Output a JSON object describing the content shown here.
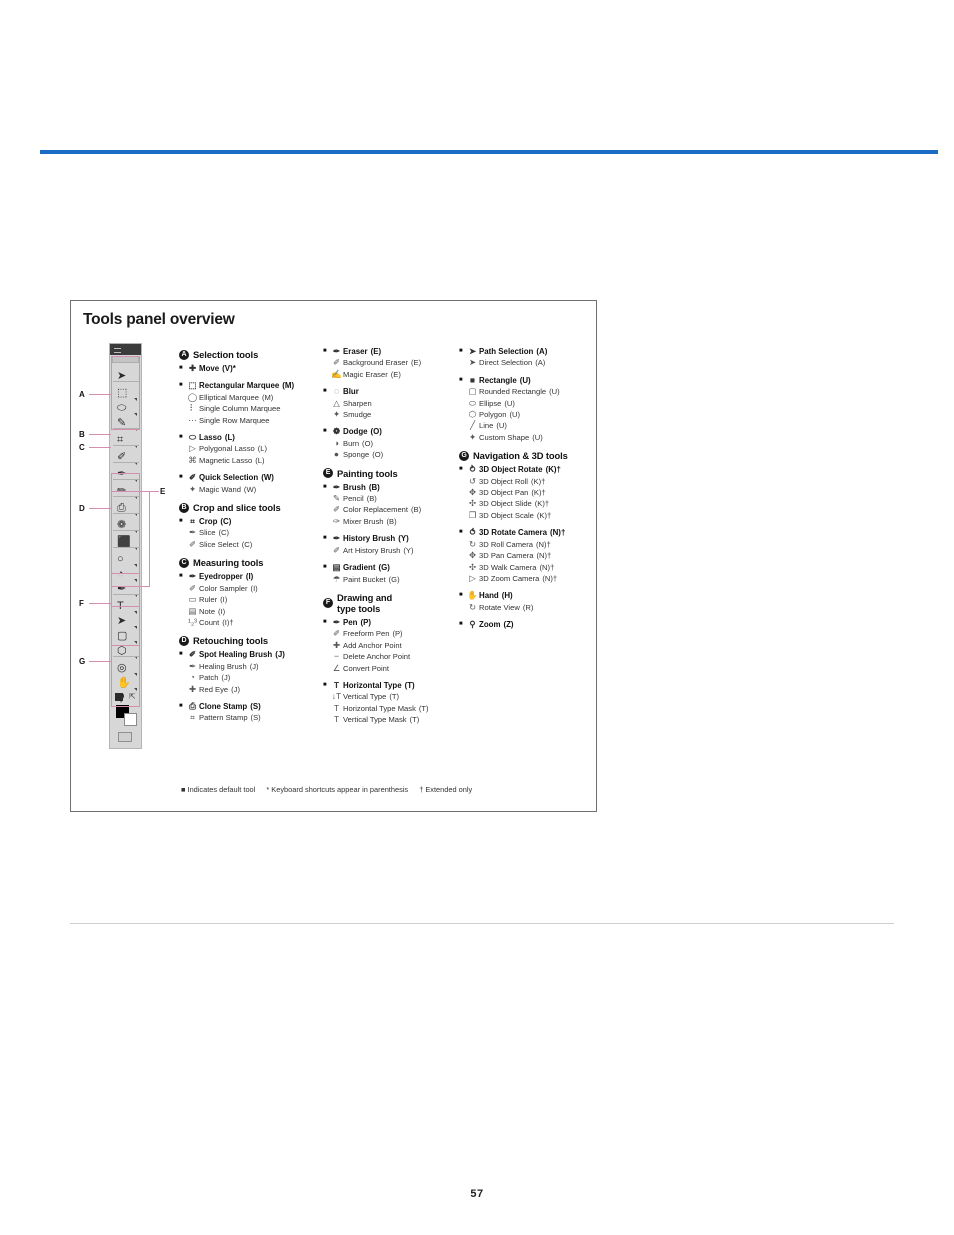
{
  "document": {
    "page_number": "57",
    "accent_color": "#1a6cc4",
    "rule_color": "#cfcfcf"
  },
  "figure": {
    "title": "Tools panel overview",
    "note": {
      "default_tool": "■ Indicates default tool",
      "shortcuts": "* Keyboard shortcuts appear in parenthesis",
      "extended": "† Extended only"
    },
    "callouts": [
      "A",
      "B",
      "C",
      "D",
      "E",
      "F",
      "G"
    ],
    "toolbar": {
      "items": [
        {
          "glyph": "➤",
          "flyout": false
        },
        {
          "glyph": "⬚",
          "flyout": true
        },
        {
          "glyph": "⬭",
          "flyout": true
        },
        {
          "glyph": "✎",
          "flyout": true
        },
        {
          "glyph": "⌗",
          "flyout": true
        },
        {
          "glyph": "✐",
          "flyout": true
        },
        {
          "glyph": "✒",
          "flyout": true
        },
        {
          "glyph": "✏",
          "flyout": true
        },
        {
          "glyph": "⎙",
          "flyout": true
        },
        {
          "glyph": "❁",
          "flyout": true
        },
        {
          "glyph": "⬛",
          "flyout": true
        },
        {
          "glyph": "○",
          "flyout": true
        },
        {
          "glyph": "◔",
          "flyout": true
        },
        {
          "glyph": "✒",
          "flyout": true
        },
        {
          "glyph": "T",
          "flyout": true
        },
        {
          "glyph": "➤",
          "flyout": true
        },
        {
          "glyph": "▢",
          "flyout": true
        },
        {
          "glyph": "⬡",
          "flyout": true
        },
        {
          "glyph": "◎",
          "flyout": true
        },
        {
          "glyph": "✋",
          "flyout": true
        },
        {
          "glyph": "⚲",
          "flyout": false
        }
      ]
    },
    "sections": [
      {
        "badge": "A",
        "title": "Selection tools",
        "column": 1,
        "groups": [
          {
            "tools": [
              {
                "default": true,
                "icon": "✚",
                "name": "Move",
                "key": "(V)*",
                "main": true
              }
            ]
          },
          {
            "tools": [
              {
                "default": true,
                "icon": "⬚",
                "name": "Rectangular Marquee",
                "key": "(M)",
                "main": true
              },
              {
                "default": false,
                "icon": "◯",
                "name": "Elliptical Marquee",
                "key": "(M)",
                "main": false
              },
              {
                "default": false,
                "icon": "⠇",
                "name": "Single Column Marquee",
                "key": "",
                "main": false
              },
              {
                "default": false,
                "icon": "⋯",
                "name": "Single Row Marquee",
                "key": "",
                "main": false
              }
            ]
          },
          {
            "tools": [
              {
                "default": true,
                "icon": "⬭",
                "name": "Lasso",
                "key": "(L)",
                "main": true
              },
              {
                "default": false,
                "icon": "▷",
                "name": "Polygonal Lasso",
                "key": "(L)",
                "main": false
              },
              {
                "default": false,
                "icon": "⌘",
                "name": "Magnetic Lasso",
                "key": "(L)",
                "main": false
              }
            ]
          },
          {
            "tools": [
              {
                "default": true,
                "icon": "✐",
                "name": "Quick Selection",
                "key": "(W)",
                "main": true
              },
              {
                "default": false,
                "icon": "✦",
                "name": "Magic Wand",
                "key": "(W)",
                "main": false
              }
            ]
          }
        ]
      },
      {
        "badge": "B",
        "title": "Crop and slice tools",
        "column": 1,
        "groups": [
          {
            "tools": [
              {
                "default": true,
                "icon": "⌗",
                "name": "Crop",
                "key": "(C)",
                "main": true
              },
              {
                "default": false,
                "icon": "✒",
                "name": "Slice",
                "key": "(C)",
                "main": false
              },
              {
                "default": false,
                "icon": "✐",
                "name": "Slice Select",
                "key": "(C)",
                "main": false
              }
            ]
          }
        ]
      },
      {
        "badge": "C",
        "title": "Measuring tools",
        "column": 1,
        "groups": [
          {
            "tools": [
              {
                "default": true,
                "icon": "✒",
                "name": "Eyedropper",
                "key": "(I)",
                "main": true
              },
              {
                "default": false,
                "icon": "✐",
                "name": "Color Sampler",
                "key": "(I)",
                "main": false
              },
              {
                "default": false,
                "icon": "▭",
                "name": "Ruler",
                "key": "(I)",
                "main": false
              },
              {
                "default": false,
                "icon": "▤",
                "name": "Note",
                "key": "(I)",
                "main": false
              },
              {
                "default": false,
                "icon": "¹₂³",
                "name": "Count",
                "key": "(I)†",
                "main": false
              }
            ]
          }
        ]
      },
      {
        "badge": "D",
        "title": "Retouching tools",
        "column": 1,
        "groups": [
          {
            "tools": [
              {
                "default": true,
                "icon": "✐",
                "name": "Spot Healing Brush",
                "key": "(J)",
                "main": true
              },
              {
                "default": false,
                "icon": "✒",
                "name": "Healing Brush",
                "key": "(J)",
                "main": false
              },
              {
                "default": false,
                "icon": "◔",
                "name": "Patch",
                "key": "(J)",
                "main": false
              },
              {
                "default": false,
                "icon": "✚",
                "name": "Red Eye",
                "key": "(J)",
                "main": false
              }
            ]
          },
          {
            "tools": [
              {
                "default": true,
                "icon": "⎙",
                "name": "Clone Stamp",
                "key": "(S)",
                "main": true
              },
              {
                "default": false,
                "icon": "⌗",
                "name": "Pattern Stamp",
                "key": "(S)",
                "main": false
              }
            ]
          }
        ]
      },
      {
        "badge": "",
        "title": "",
        "column": 2,
        "groups": [
          {
            "tools": [
              {
                "default": true,
                "icon": "✒",
                "name": "Eraser",
                "key": "(E)",
                "main": true
              },
              {
                "default": false,
                "icon": "✐",
                "name": "Background Eraser",
                "key": "(E)",
                "main": false
              },
              {
                "default": false,
                "icon": "✍",
                "name": "Magic Eraser",
                "key": "(E)",
                "main": false
              }
            ]
          },
          {
            "tools": [
              {
                "default": true,
                "icon": "◌",
                "name": "Blur",
                "key": "",
                "main": true
              },
              {
                "default": false,
                "icon": "△",
                "name": "Sharpen",
                "key": "",
                "main": false
              },
              {
                "default": false,
                "icon": "✦",
                "name": "Smudge",
                "key": "",
                "main": false
              }
            ]
          },
          {
            "tools": [
              {
                "default": true,
                "icon": "❁",
                "name": "Dodge",
                "key": "(O)",
                "main": true
              },
              {
                "default": false,
                "icon": "◑",
                "name": "Burn",
                "key": "(O)",
                "main": false
              },
              {
                "default": false,
                "icon": "●",
                "name": "Sponge",
                "key": "(O)",
                "main": false
              }
            ]
          }
        ]
      },
      {
        "badge": "E",
        "title": "Painting tools",
        "column": 2,
        "groups": [
          {
            "tools": [
              {
                "default": true,
                "icon": "✒",
                "name": "Brush",
                "key": "(B)",
                "main": true
              },
              {
                "default": false,
                "icon": "✎",
                "name": "Pencil",
                "key": "(B)",
                "main": false
              },
              {
                "default": false,
                "icon": "✐",
                "name": "Color Replacement",
                "key": "(B)",
                "main": false
              },
              {
                "default": false,
                "icon": "✑",
                "name": "Mixer Brush",
                "key": "(B)",
                "main": false
              }
            ]
          },
          {
            "tools": [
              {
                "default": true,
                "icon": "✒",
                "name": "History Brush",
                "key": "(Y)",
                "main": true
              },
              {
                "default": false,
                "icon": "✐",
                "name": "Art History Brush",
                "key": "(Y)",
                "main": false
              }
            ]
          },
          {
            "tools": [
              {
                "default": true,
                "icon": "▤",
                "name": "Gradient",
                "key": "(G)",
                "main": true
              },
              {
                "default": false,
                "icon": "☂",
                "name": "Paint Bucket",
                "key": "(G)",
                "main": false
              }
            ]
          }
        ]
      },
      {
        "badge": "F",
        "title": "Drawing and\ntype tools",
        "column": 2,
        "groups": [
          {
            "tools": [
              {
                "default": true,
                "icon": "✒",
                "name": "Pen",
                "key": "(P)",
                "main": true
              },
              {
                "default": false,
                "icon": "✐",
                "name": "Freeform Pen",
                "key": "(P)",
                "main": false
              },
              {
                "default": false,
                "icon": "✚",
                "name": "Add Anchor Point",
                "key": "",
                "main": false
              },
              {
                "default": false,
                "icon": "−",
                "name": "Delete Anchor Point",
                "key": "",
                "main": false
              },
              {
                "default": false,
                "icon": "∠",
                "name": "Convert Point",
                "key": "",
                "main": false
              }
            ]
          },
          {
            "tools": [
              {
                "default": true,
                "icon": "T",
                "name": "Horizontal Type",
                "key": "(T)",
                "main": true
              },
              {
                "default": false,
                "icon": "↓T",
                "name": "Vertical Type",
                "key": "(T)",
                "main": false
              },
              {
                "default": false,
                "icon": "T",
                "name": "Horizontal Type Mask",
                "key": "(T)",
                "main": false
              },
              {
                "default": false,
                "icon": "T",
                "name": "Vertical Type Mask",
                "key": "(T)",
                "main": false
              }
            ]
          }
        ]
      },
      {
        "badge": "",
        "title": "",
        "column": 3,
        "groups": [
          {
            "tools": [
              {
                "default": true,
                "icon": "➤",
                "name": "Path Selection",
                "key": "(A)",
                "main": true
              },
              {
                "default": false,
                "icon": "➤",
                "name": "Direct Selection",
                "key": "(A)",
                "main": false
              }
            ]
          },
          {
            "tools": [
              {
                "default": true,
                "icon": "■",
                "name": "Rectangle",
                "key": "(U)",
                "main": true
              },
              {
                "default": false,
                "icon": "▢",
                "name": "Rounded Rectangle",
                "key": "(U)",
                "main": false
              },
              {
                "default": false,
                "icon": "⬭",
                "name": "Ellipse",
                "key": "(U)",
                "main": false
              },
              {
                "default": false,
                "icon": "⬡",
                "name": "Polygon",
                "key": "(U)",
                "main": false
              },
              {
                "default": false,
                "icon": "╱",
                "name": "Line",
                "key": "(U)",
                "main": false
              },
              {
                "default": false,
                "icon": "✦",
                "name": "Custom Shape",
                "key": "(U)",
                "main": false
              }
            ]
          }
        ]
      },
      {
        "badge": "G",
        "title": "Navigation & 3D tools",
        "column": 3,
        "groups": [
          {
            "tools": [
              {
                "default": true,
                "icon": "⥁",
                "name": "3D Object Rotate",
                "key": "(K)†",
                "main": true
              },
              {
                "default": false,
                "icon": "↺",
                "name": "3D Object Roll",
                "key": "(K)†",
                "main": false
              },
              {
                "default": false,
                "icon": "✥",
                "name": "3D Object Pan",
                "key": "(K)†",
                "main": false
              },
              {
                "default": false,
                "icon": "✣",
                "name": "3D Object Slide",
                "key": "(K)†",
                "main": false
              },
              {
                "default": false,
                "icon": "❐",
                "name": "3D Object Scale",
                "key": "(K)†",
                "main": false
              }
            ]
          },
          {
            "tools": [
              {
                "default": true,
                "icon": "⥀",
                "name": "3D Rotate Camera",
                "key": "(N)†",
                "main": true
              },
              {
                "default": false,
                "icon": "↻",
                "name": "3D Roll Camera",
                "key": "(N)†",
                "main": false
              },
              {
                "default": false,
                "icon": "✥",
                "name": "3D Pan Camera",
                "key": "(N)†",
                "main": false
              },
              {
                "default": false,
                "icon": "✣",
                "name": "3D Walk Camera",
                "key": "(N)†",
                "main": false
              },
              {
                "default": false,
                "icon": "▷",
                "name": "3D Zoom Camera",
                "key": "(N)†",
                "main": false
              }
            ]
          },
          {
            "tools": [
              {
                "default": true,
                "icon": "✋",
                "name": "Hand",
                "key": "(H)",
                "main": true
              },
              {
                "default": false,
                "icon": "↻",
                "name": "Rotate View",
                "key": "(R)",
                "main": false
              }
            ]
          },
          {
            "tools": [
              {
                "default": true,
                "icon": "⚲",
                "name": "Zoom",
                "key": "(Z)",
                "main": true
              }
            ]
          }
        ]
      }
    ]
  }
}
